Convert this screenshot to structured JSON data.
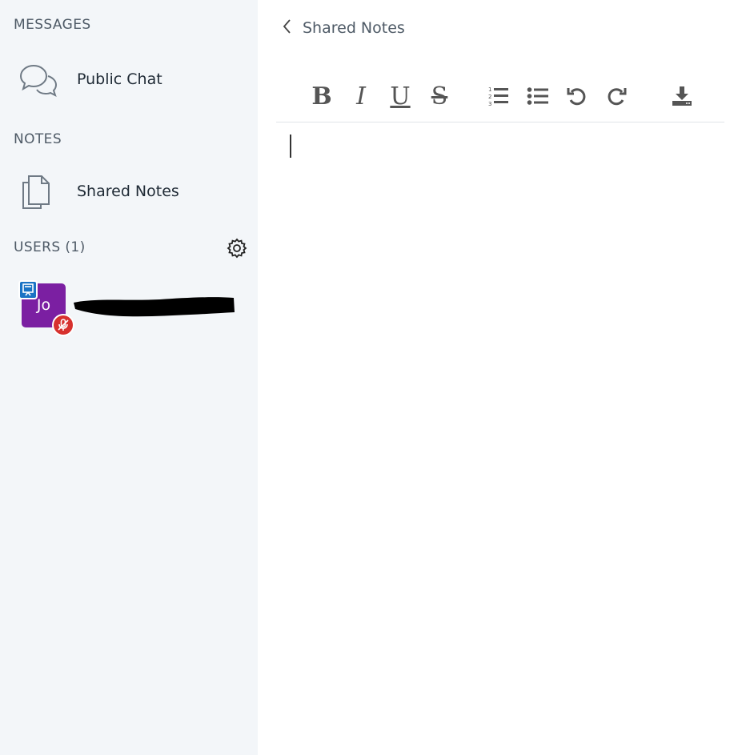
{
  "sidebar": {
    "messages_title": "MESSAGES",
    "public_chat": {
      "label": "Public Chat",
      "icon": "chat-bubbles-icon"
    },
    "notes_title": "NOTES",
    "shared_notes": {
      "label": "Shared Notes",
      "icon": "documents-icon"
    },
    "users_title": "USERS (1)",
    "users": [
      {
        "initials": "Jo",
        "avatar_color": "#7b1fa2",
        "is_presenter": true,
        "is_muted": true,
        "name_redacted": true
      }
    ]
  },
  "notes_panel": {
    "back_label": "Shared Notes",
    "toolbar": [
      {
        "name": "bold",
        "glyph": "B"
      },
      {
        "name": "italic",
        "glyph": "I"
      },
      {
        "name": "underline",
        "glyph": "U"
      },
      {
        "name": "strikethrough",
        "glyph": "S"
      },
      {
        "name": "ordered-list"
      },
      {
        "name": "bullet-list"
      },
      {
        "name": "undo"
      },
      {
        "name": "redo"
      },
      {
        "name": "download"
      }
    ],
    "editor_content": ""
  },
  "colors": {
    "sidebar_bg": "#f3f6f9",
    "presenter_badge": "#1a73c4",
    "muted_badge": "#d7312e"
  }
}
